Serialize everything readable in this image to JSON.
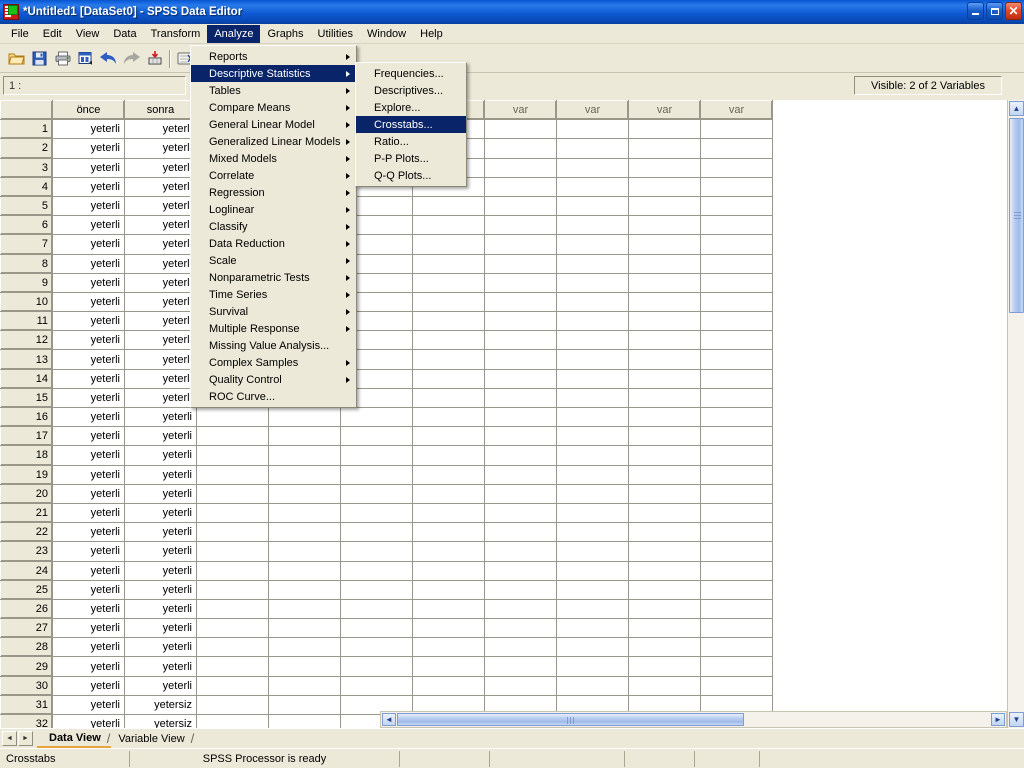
{
  "window": {
    "title": "*Untitled1 [DataSet0] - SPSS Data Editor",
    "icon": "spss-icon",
    "minimize_label": "Minimize",
    "restore_label": "Restore",
    "close_label": "Close"
  },
  "menubar": {
    "items": [
      {
        "label": "File",
        "active": false
      },
      {
        "label": "Edit",
        "active": false
      },
      {
        "label": "View",
        "active": false
      },
      {
        "label": "Data",
        "active": false
      },
      {
        "label": "Transform",
        "active": false
      },
      {
        "label": "Analyze",
        "active": true
      },
      {
        "label": "Graphs",
        "active": false
      },
      {
        "label": "Utilities",
        "active": false
      },
      {
        "label": "Window",
        "active": false
      },
      {
        "label": "Help",
        "active": false
      }
    ]
  },
  "toolbar": {
    "icons": [
      "open-file-icon",
      "save-file-icon",
      "print-icon",
      "recall-dialog-icon",
      "undo-icon",
      "redo-icon",
      "goto-case-icon",
      "variables-icon",
      "find-icon",
      "insert-case-icon"
    ]
  },
  "cellbar": {
    "cell_reference": "1 :",
    "cell_value": "",
    "visible_variables": "Visible: 2 of 2 Variables"
  },
  "analyze_menu": {
    "items": [
      {
        "label": "Reports",
        "submenu": true,
        "selected": false
      },
      {
        "label": "Descriptive Statistics",
        "submenu": true,
        "selected": true
      },
      {
        "label": "Tables",
        "submenu": true,
        "selected": false
      },
      {
        "label": "Compare Means",
        "submenu": true,
        "selected": false
      },
      {
        "label": "General Linear Model",
        "submenu": true,
        "selected": false
      },
      {
        "label": "Generalized Linear Models",
        "submenu": true,
        "selected": false
      },
      {
        "label": "Mixed Models",
        "submenu": true,
        "selected": false
      },
      {
        "label": "Correlate",
        "submenu": true,
        "selected": false
      },
      {
        "label": "Regression",
        "submenu": true,
        "selected": false
      },
      {
        "label": "Loglinear",
        "submenu": true,
        "selected": false
      },
      {
        "label": "Classify",
        "submenu": true,
        "selected": false
      },
      {
        "label": "Data Reduction",
        "submenu": true,
        "selected": false
      },
      {
        "label": "Scale",
        "submenu": true,
        "selected": false
      },
      {
        "label": "Nonparametric Tests",
        "submenu": true,
        "selected": false
      },
      {
        "label": "Time Series",
        "submenu": true,
        "selected": false
      },
      {
        "label": "Survival",
        "submenu": true,
        "selected": false
      },
      {
        "label": "Multiple Response",
        "submenu": true,
        "selected": false
      },
      {
        "label": "Missing Value Analysis...",
        "submenu": false,
        "selected": false
      },
      {
        "label": "Complex Samples",
        "submenu": true,
        "selected": false
      },
      {
        "label": "Quality Control",
        "submenu": true,
        "selected": false
      },
      {
        "label": "ROC Curve...",
        "submenu": false,
        "selected": false
      }
    ]
  },
  "descriptive_submenu": {
    "items": [
      {
        "label": "Frequencies...",
        "selected": false
      },
      {
        "label": "Descriptives...",
        "selected": false
      },
      {
        "label": "Explore...",
        "selected": false
      },
      {
        "label": "Crosstabs...",
        "selected": true
      },
      {
        "label": "Ratio...",
        "selected": false
      },
      {
        "label": "P-P Plots...",
        "selected": false
      },
      {
        "label": "Q-Q Plots...",
        "selected": false
      }
    ]
  },
  "grid": {
    "corner_label": "",
    "columns": [
      "önce",
      "sonra",
      "var",
      "var",
      "var",
      "var",
      "var",
      "var",
      "var",
      "var"
    ],
    "named_column_count": 2,
    "rows": [
      {
        "n": "1",
        "onap": "yeterli",
        "sonra": "yeterli"
      },
      {
        "n": "2",
        "onap": "yeterli",
        "sonra": "yeterli"
      },
      {
        "n": "3",
        "onap": "yeterli",
        "sonra": "yeterli"
      },
      {
        "n": "4",
        "onap": "yeterli",
        "sonra": "yeterli"
      },
      {
        "n": "5",
        "onap": "yeterli",
        "sonra": "yeterli"
      },
      {
        "n": "6",
        "onap": "yeterli",
        "sonra": "yeterli"
      },
      {
        "n": "7",
        "onap": "yeterli",
        "sonra": "yeterli"
      },
      {
        "n": "8",
        "onap": "yeterli",
        "sonra": "yeterli"
      },
      {
        "n": "9",
        "onap": "yeterli",
        "sonra": "yeterli"
      },
      {
        "n": "10",
        "onap": "yeterli",
        "sonra": "yeterli"
      },
      {
        "n": "11",
        "onap": "yeterli",
        "sonra": "yeterli"
      },
      {
        "n": "12",
        "onap": "yeterli",
        "sonra": "yeterli"
      },
      {
        "n": "13",
        "onap": "yeterli",
        "sonra": "yeterli"
      },
      {
        "n": "14",
        "onap": "yeterli",
        "sonra": "yeterli"
      },
      {
        "n": "15",
        "onap": "yeterli",
        "sonra": "yeterli"
      },
      {
        "n": "16",
        "onap": "yeterli",
        "sonra": "yeterli"
      },
      {
        "n": "17",
        "onap": "yeterli",
        "sonra": "yeterli"
      },
      {
        "n": "18",
        "onap": "yeterli",
        "sonra": "yeterli"
      },
      {
        "n": "19",
        "onap": "yeterli",
        "sonra": "yeterli"
      },
      {
        "n": "20",
        "onap": "yeterli",
        "sonra": "yeterli"
      },
      {
        "n": "21",
        "onap": "yeterli",
        "sonra": "yeterli"
      },
      {
        "n": "22",
        "onap": "yeterli",
        "sonra": "yeterli"
      },
      {
        "n": "23",
        "onap": "yeterli",
        "sonra": "yeterli"
      },
      {
        "n": "24",
        "onap": "yeterli",
        "sonra": "yeterli"
      },
      {
        "n": "25",
        "onap": "yeterli",
        "sonra": "yeterli"
      },
      {
        "n": "26",
        "onap": "yeterli",
        "sonra": "yeterli"
      },
      {
        "n": "27",
        "onap": "yeterli",
        "sonra": "yeterli"
      },
      {
        "n": "28",
        "onap": "yeterli",
        "sonra": "yeterli"
      },
      {
        "n": "29",
        "onap": "yeterli",
        "sonra": "yeterli"
      },
      {
        "n": "30",
        "onap": "yeterli",
        "sonra": "yeterli"
      },
      {
        "n": "31",
        "onap": "yeterli",
        "sonra": "yetersiz"
      },
      {
        "n": "32",
        "onap": "yeterli",
        "sonra": "yetersiz"
      }
    ]
  },
  "view_tabs": {
    "prev_label": "◄",
    "next_label": "►",
    "tabs": [
      {
        "label": "Data View",
        "active": true
      },
      {
        "label": "Variable View",
        "active": false
      }
    ]
  },
  "statusbar": {
    "left_text": "Crosstabs",
    "processor_text": "SPSS Processor is ready"
  },
  "colors": {
    "title_blue": "#0a54c8",
    "menu_highlight": "#0a246a",
    "face": "#ece9d8",
    "grid_line": "#9a968a",
    "tab_underline": "#e8a33d"
  }
}
